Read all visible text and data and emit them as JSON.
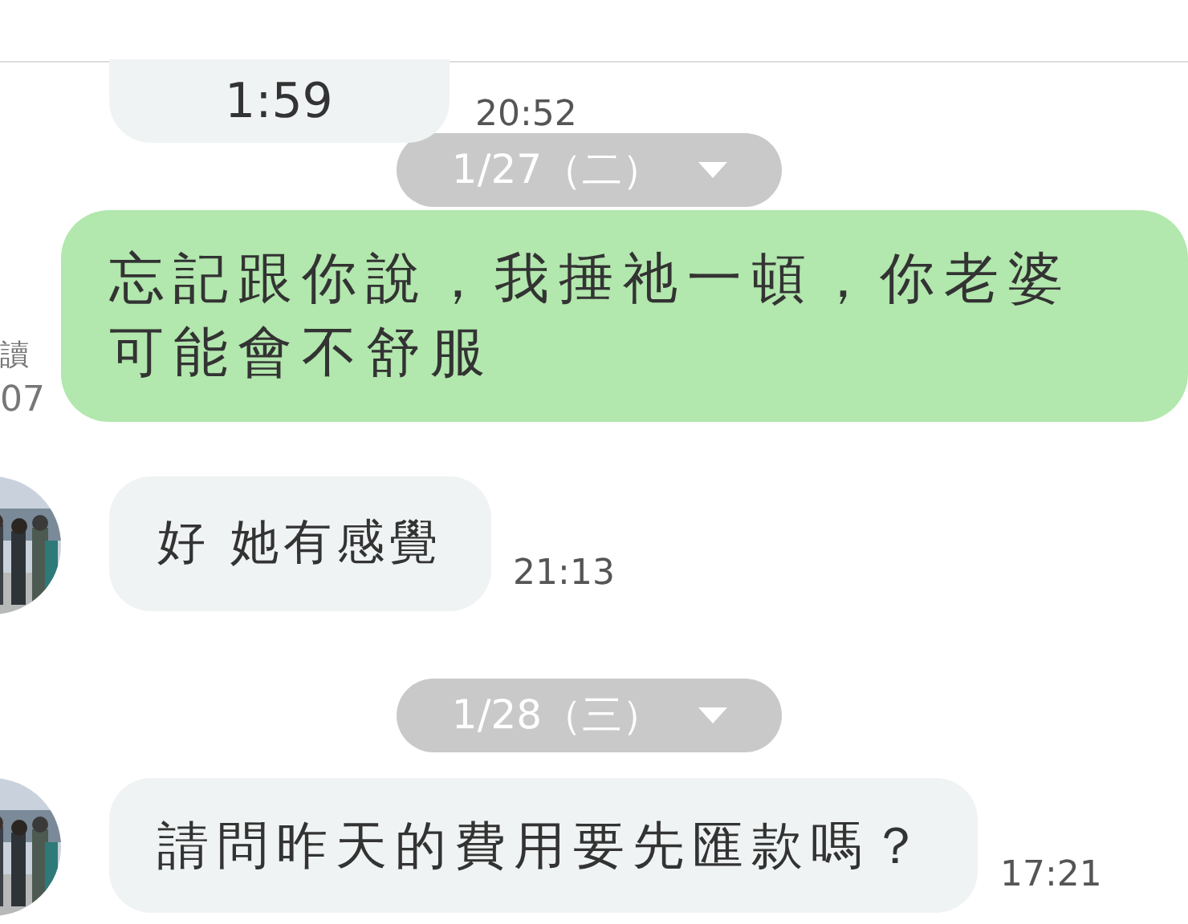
{
  "messages": [
    {
      "kind": "incoming",
      "text": "1:59",
      "time": "20:52",
      "avatar": false,
      "cut_top": true
    },
    {
      "kind": "date",
      "text": "1/27（二）"
    },
    {
      "kind": "outgoing",
      "text": "忘記跟你說，我捶祂一頓，你老婆可能會不舒服",
      "status": "讀",
      "time": "07"
    },
    {
      "kind": "incoming",
      "text": "好 她有感覺",
      "time": "21:13",
      "avatar": true,
      "cut_top": false
    },
    {
      "kind": "date",
      "text": "1/28（三）"
    },
    {
      "kind": "incoming",
      "text": "請問昨天的費用要先匯款嗎？",
      "time": "17:21",
      "avatar": true,
      "cut_top": false
    }
  ]
}
